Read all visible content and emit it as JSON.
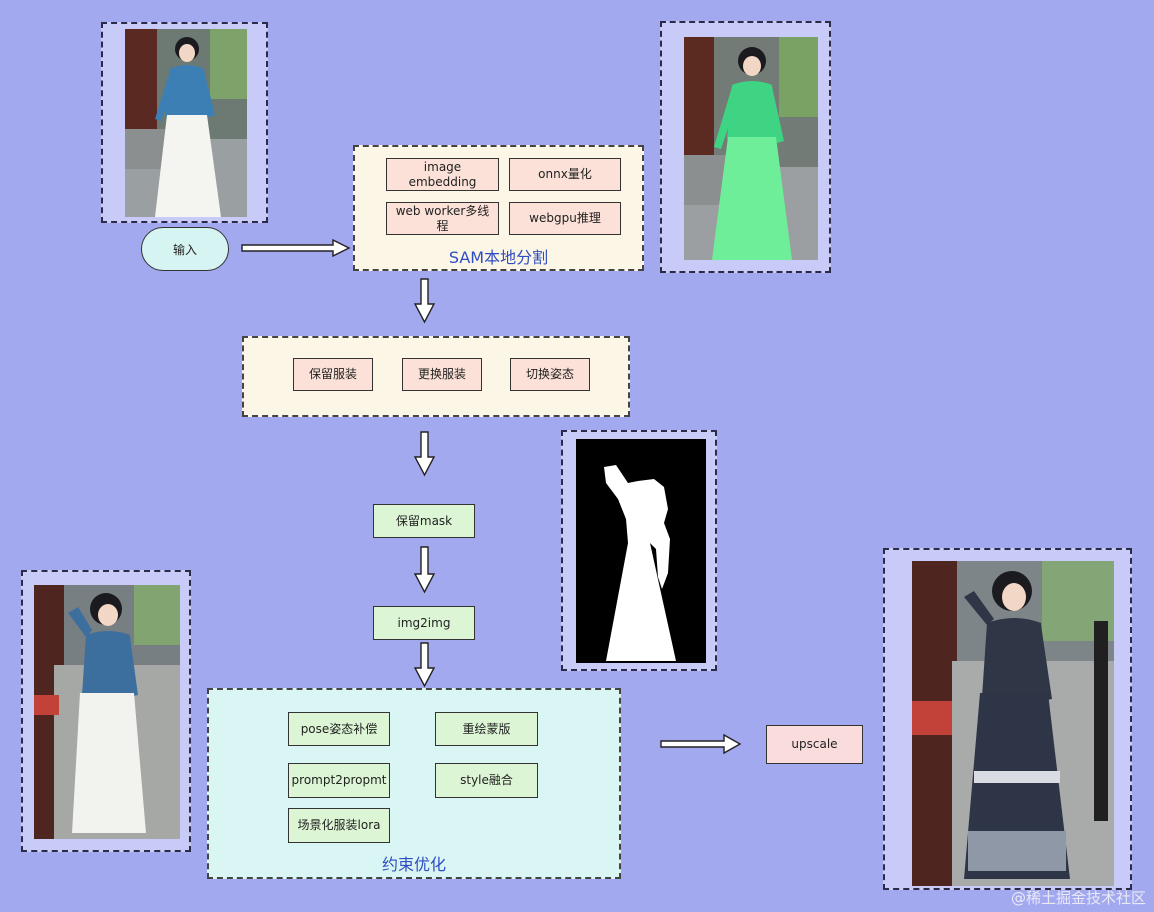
{
  "input": {
    "label": "输入"
  },
  "sam": {
    "title": "SAM本地分割",
    "items": [
      "image embedding",
      "onnx量化",
      "web worker多线程",
      "webgpu推理"
    ]
  },
  "modes": {
    "items": [
      "保留服装",
      "更换服装",
      "切换姿态"
    ]
  },
  "pipeline": {
    "mask": "保留mask",
    "img2img": "img2img",
    "upscale": "upscale"
  },
  "constraint": {
    "title": "约束优化",
    "items": [
      "pose姿态补偿",
      "重绘蒙版",
      "prompt2propmt",
      "style融合",
      "场景化服装lora"
    ]
  },
  "watermark": "@稀土掘金技术社区",
  "colors": {
    "background": "#a3a9ef",
    "frame": "#c8cbf7",
    "cream_panel": "#fcf6e6",
    "cyan_panel": "#d9f6f4",
    "peach_box": "#fbe1d7",
    "green_box": "#dcf5d4",
    "pink_box": "#fadcdc",
    "title_blue": "#2f4cc2"
  }
}
